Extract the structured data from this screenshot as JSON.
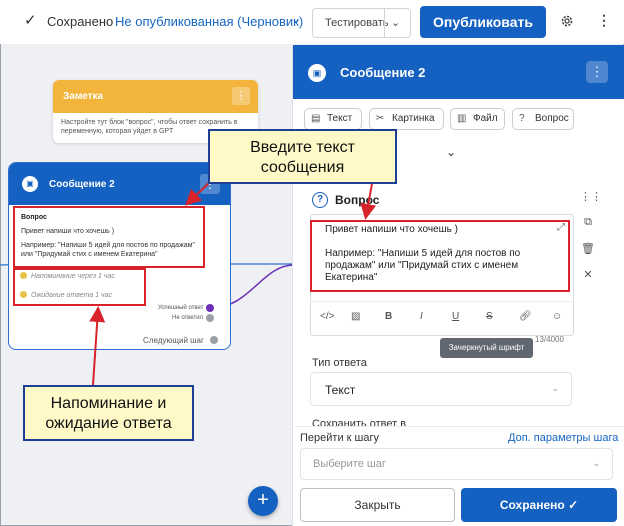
{
  "topbar": {
    "saved_status": "Сохранено",
    "draft_status": "Не опубликованная (Черновик)",
    "test_label": "Тестировать",
    "publish_label": "Опубликовать"
  },
  "note": {
    "title": "Заметка",
    "body": "Настройте тут блок \"вопрос\", чтобы ответ сохранить в переменную, которая уйдет в GPT"
  },
  "node": {
    "title": "Сообщение 2",
    "question_title": "Вопрос",
    "line1": "Привет напиши что хочешь )",
    "line2": "Например: \"Напиши 5 идей для постов по продажам\"",
    "line3": "или \"Придумай стих с именем Екатерина\"",
    "reminder": "Напоминание через 1 час",
    "waiting": "Ожидание ответа 1 час",
    "success_port": "Успешный ответ",
    "fail_port": "Не ответил",
    "next_step": "Следующий шаг"
  },
  "panel": {
    "title": "Сообщение 2",
    "chips": [
      "Текст",
      "Картинка",
      "Файл",
      "Вопрос"
    ],
    "question_title": "Вопрос",
    "editor_line1": "Привет напиши что хочешь )",
    "editor_line2": "Например: \"Напиши 5 идей для постов по",
    "editor_line3": "продажам\" или \"Придумай стих с именем",
    "editor_line4": "Екатерина\"",
    "counter": "13/4000",
    "tooltip": "Зачеркнутый шрифт",
    "response_type_label": "Тип ответа",
    "response_type_value": "Текст",
    "save_answer_label": "Сохранить ответ в",
    "goto_label": "Перейти к шагу",
    "goto_link": "Доп. параметры шага",
    "goto_placeholder": "Выберите шаг",
    "close_label": "Закрыть",
    "saved_label": "Сохранено"
  },
  "callouts": {
    "enter_text": "Введите текст сообщения",
    "reminder_waiting": "Напоминание и ожидание ответа"
  },
  "colors": {
    "primary": "#1561c1",
    "note_header": "#f2b43a",
    "highlight_red": "#d8232a",
    "callout_fill": "#fff9c8",
    "port_success": "#6b2fb3"
  },
  "icons": {
    "check": "check-icon",
    "gear": "gear-icon",
    "add": "plus-icon"
  }
}
